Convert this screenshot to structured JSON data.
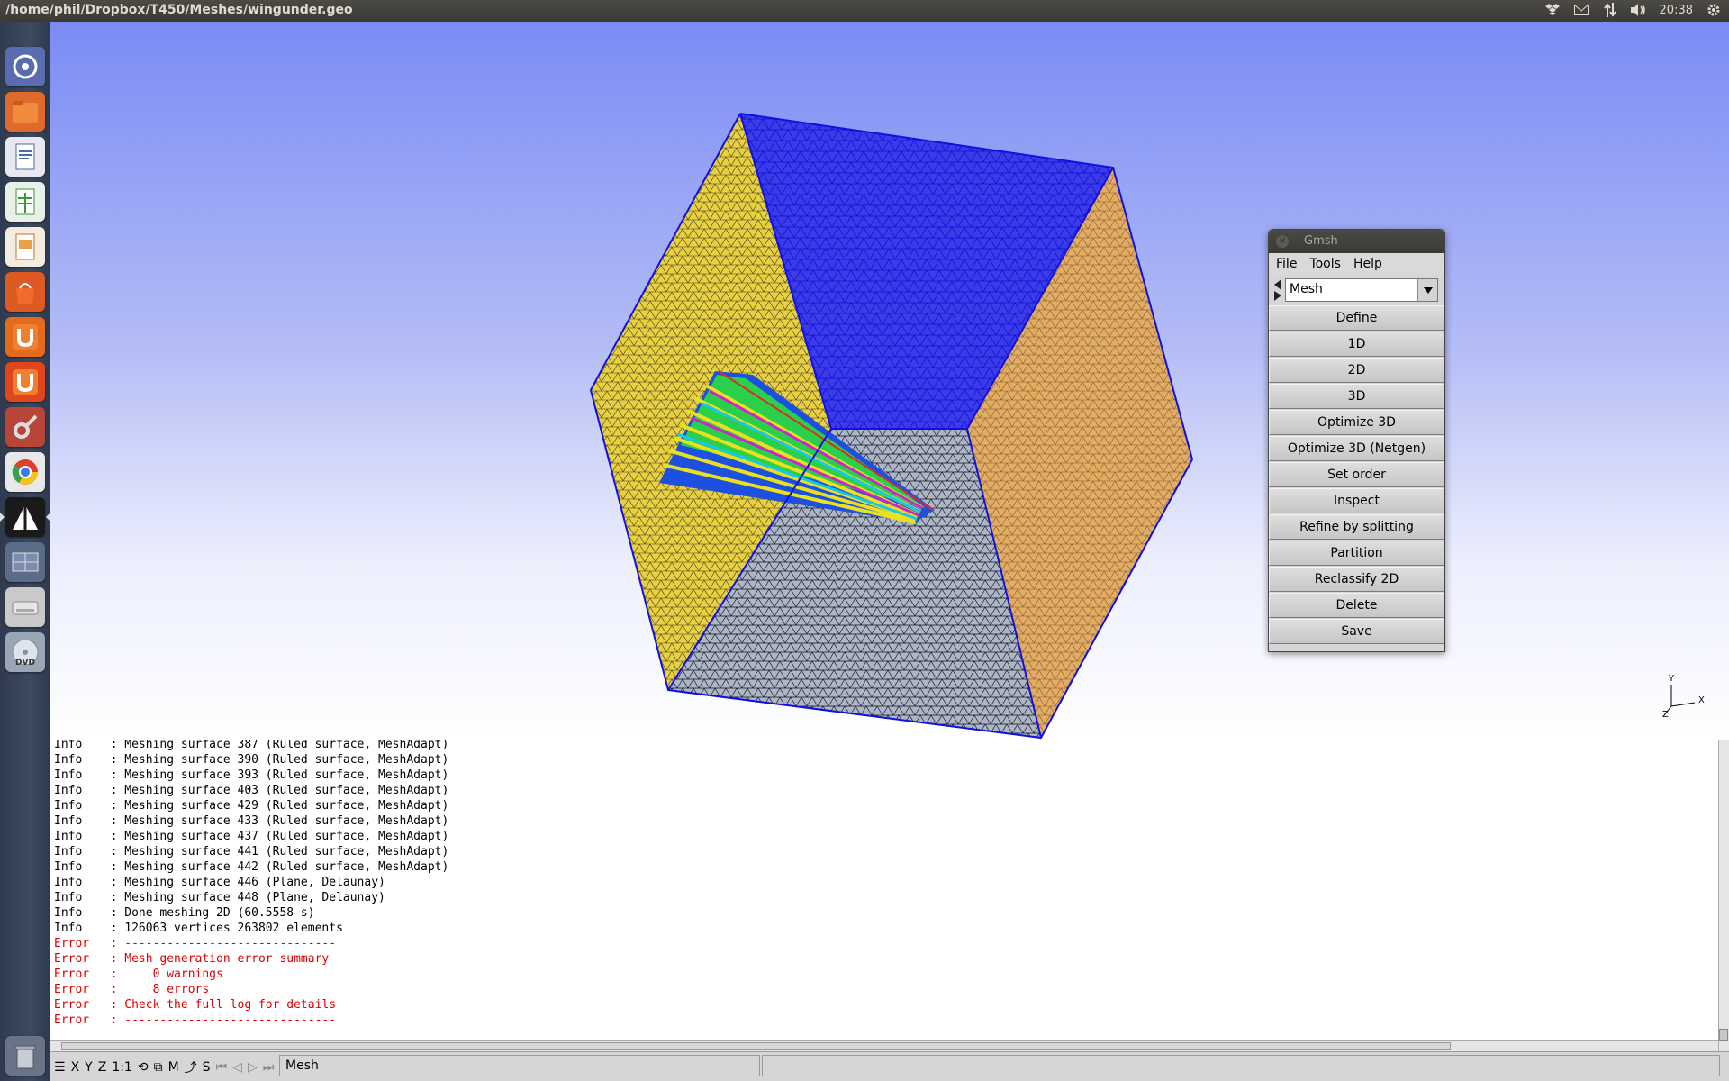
{
  "window": {
    "title": "/home/phil/Dropbox/T450/Meshes/wingunder.geo"
  },
  "tray": {
    "clock": "20:38"
  },
  "launcher": {
    "items": [
      {
        "name": "dash-home-icon",
        "color": "#5a6cb0"
      },
      {
        "name": "files-icon",
        "color": "#e06a2c"
      },
      {
        "name": "writer-icon",
        "color": "#e8e8f0"
      },
      {
        "name": "calc-icon",
        "color": "#e8f0e8"
      },
      {
        "name": "impress-icon",
        "color": "#f4ece0"
      },
      {
        "name": "software-center-icon",
        "color": "#dd5a22"
      },
      {
        "name": "ubuntu-one-icon",
        "color": "#e46a1c"
      },
      {
        "name": "ubuntu-one-music-icon",
        "color": "#e0451c"
      },
      {
        "name": "system-settings-icon",
        "color": "#b8453a"
      },
      {
        "name": "chrome-icon",
        "color": "#e8e8e8"
      },
      {
        "name": "gmsh-icon",
        "color": "#1a1a1a"
      },
      {
        "name": "workspace-switcher-icon",
        "color": "#5a6c88"
      },
      {
        "name": "drive-icon",
        "color": "#c9c9c9"
      },
      {
        "name": "dvd-icon",
        "color": "#9aa5b5"
      }
    ],
    "trash": "trash-icon"
  },
  "gmsh": {
    "title": "Gmsh",
    "menu": {
      "file": "File",
      "tools": "Tools",
      "help": "Help"
    },
    "mode": "Mesh",
    "buttons": [
      "Define",
      "1D",
      "2D",
      "3D",
      "Optimize 3D",
      "Optimize 3D (Netgen)",
      "Set order",
      "Inspect",
      "Refine by splitting",
      "Partition",
      "Reclassify 2D",
      "Delete",
      "Save"
    ]
  },
  "axes": {
    "x": "X",
    "y": "Y",
    "z": "Z"
  },
  "console": {
    "lines": [
      {
        "level": "info",
        "text": "Info    : Meshing surface 387 (Ruled surface, MeshAdapt)"
      },
      {
        "level": "info",
        "text": "Info    : Meshing surface 390 (Ruled surface, MeshAdapt)"
      },
      {
        "level": "info",
        "text": "Info    : Meshing surface 393 (Ruled surface, MeshAdapt)"
      },
      {
        "level": "info",
        "text": "Info    : Meshing surface 403 (Ruled surface, MeshAdapt)"
      },
      {
        "level": "info",
        "text": "Info    : Meshing surface 429 (Ruled surface, MeshAdapt)"
      },
      {
        "level": "info",
        "text": "Info    : Meshing surface 433 (Ruled surface, MeshAdapt)"
      },
      {
        "level": "info",
        "text": "Info    : Meshing surface 437 (Ruled surface, MeshAdapt)"
      },
      {
        "level": "info",
        "text": "Info    : Meshing surface 441 (Ruled surface, MeshAdapt)"
      },
      {
        "level": "info",
        "text": "Info    : Meshing surface 442 (Ruled surface, MeshAdapt)"
      },
      {
        "level": "info",
        "text": "Info    : Meshing surface 446 (Plane, Delaunay)"
      },
      {
        "level": "info",
        "text": "Info    : Meshing surface 448 (Plane, Delaunay)"
      },
      {
        "level": "info",
        "text": "Info    : Done meshing 2D (60.5558 s)"
      },
      {
        "level": "info",
        "text": "Info    : 126063 vertices 263802 elements"
      },
      {
        "level": "error",
        "text": "Error   : ------------------------------"
      },
      {
        "level": "error",
        "text": "Error   : Mesh generation error summary"
      },
      {
        "level": "error",
        "text": "Error   :     0 warnings"
      },
      {
        "level": "error",
        "text": "Error   :     8 errors"
      },
      {
        "level": "error",
        "text": "Error   : Check the full log for details"
      },
      {
        "level": "error",
        "text": "Error   : ------------------------------"
      }
    ]
  },
  "statusbar": {
    "x": "X",
    "y": "Y",
    "z": "Z",
    "scale": "1:1",
    "m": "M",
    "s": "S",
    "message": "Mesh"
  },
  "colors": {
    "info": "#000000",
    "error": "#e00000",
    "mesh_blue": "#1a1ae8",
    "mesh_yellow": "#e8d040",
    "mesh_orange": "#e6a24a",
    "mesh_grey": "#9aa6b8"
  }
}
